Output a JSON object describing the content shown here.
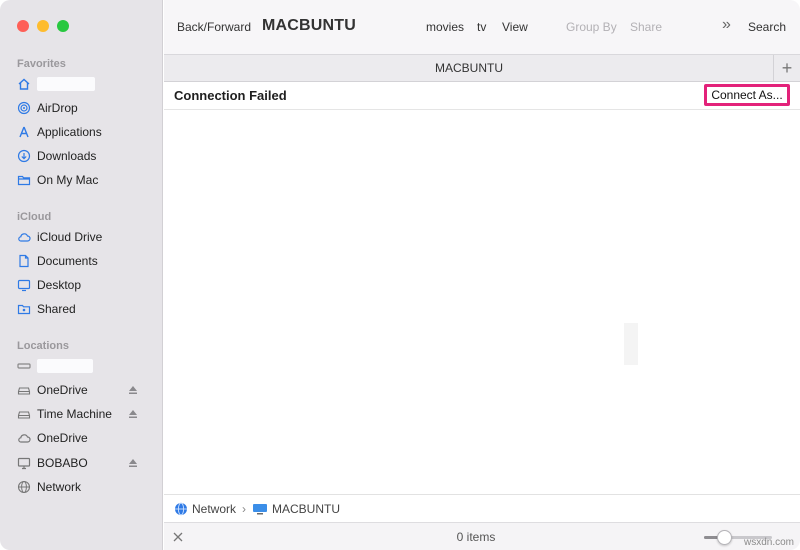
{
  "sidebar": {
    "favorites_title": "Favorites",
    "favorites": [
      {
        "label": "",
        "icon": "home-icon"
      },
      {
        "label": "AirDrop",
        "icon": "airdrop-icon"
      },
      {
        "label": "Applications",
        "icon": "applications-icon"
      },
      {
        "label": "Downloads",
        "icon": "downloads-icon"
      },
      {
        "label": "On My Mac",
        "icon": "folder-icon"
      }
    ],
    "icloud_title": "iCloud",
    "icloud": [
      {
        "label": "iCloud Drive",
        "icon": "cloud-icon"
      },
      {
        "label": "Documents",
        "icon": "document-icon"
      },
      {
        "label": "Desktop",
        "icon": "desktop-icon"
      },
      {
        "label": "Shared",
        "icon": "shared-folder-icon"
      }
    ],
    "locations_title": "Locations",
    "locations": [
      {
        "label": "",
        "icon": "drive-icon"
      },
      {
        "label": "OneDrive",
        "icon": "drive-icon",
        "eject": true
      },
      {
        "label": "Time Machine",
        "icon": "drive-icon",
        "eject": true
      },
      {
        "label": "OneDrive",
        "icon": "cloud-icon"
      },
      {
        "label": "BOBABO",
        "icon": "monitor-icon",
        "eject": true
      },
      {
        "label": "Network",
        "icon": "globe-icon"
      }
    ]
  },
  "toolbar": {
    "back_forward": "Back/Forward",
    "title": "MACBUNTU",
    "movies": "movies",
    "tv": "tv",
    "view": "View",
    "group_by": "Group By",
    "share": "Share",
    "more": "»",
    "search": "Search"
  },
  "tab": {
    "title": "MACBUNTU",
    "add": "+"
  },
  "banner": {
    "message": "Connection Failed",
    "connect_button": "Connect As..."
  },
  "pathbar": {
    "segments": [
      "Network",
      "MACBUNTU"
    ],
    "separator": "›"
  },
  "status": {
    "items": "0 items",
    "icon_size_fraction": 0.3
  },
  "colors": {
    "accent": "#2f7ae5",
    "highlight_border": "#e3227a",
    "sidebar_bg": "#e6e4e8"
  },
  "watermark": "wsxdn.com"
}
